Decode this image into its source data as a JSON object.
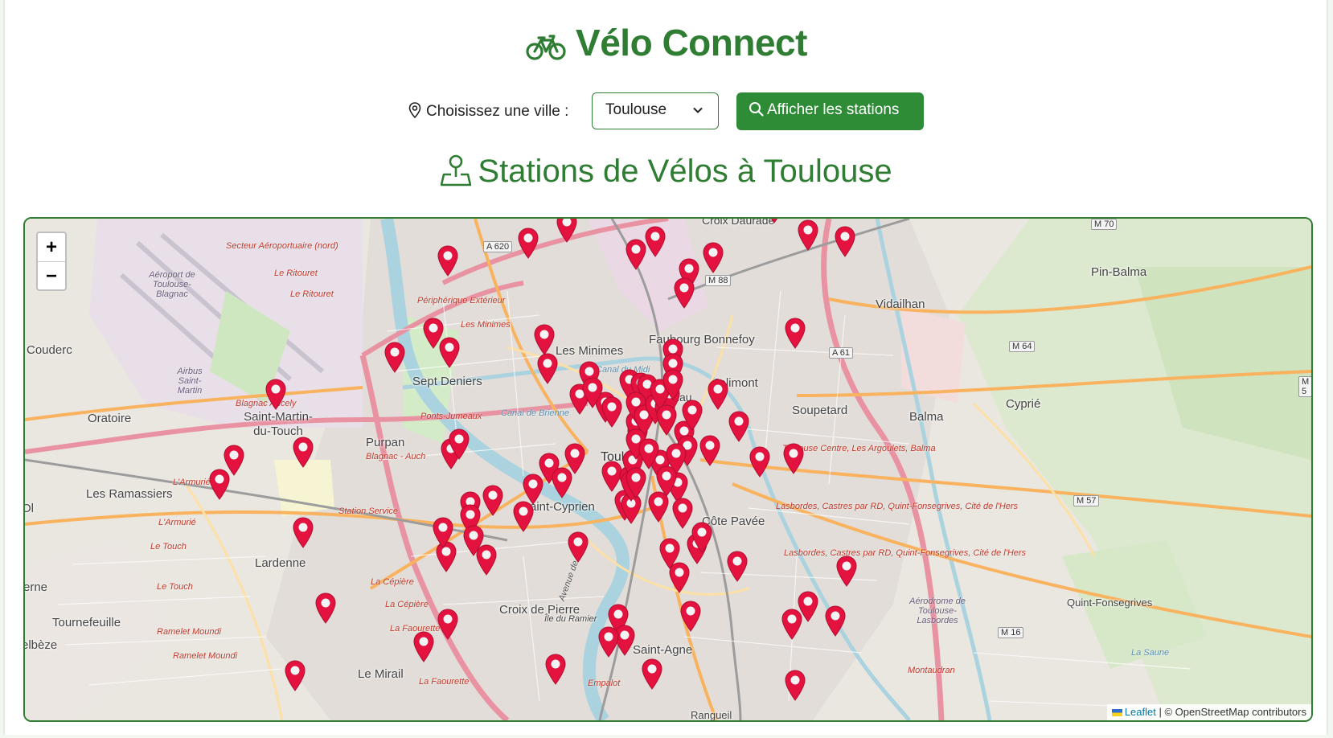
{
  "header": {
    "title": "Vélo Connect",
    "icon": "bicycle-icon",
    "brand_color": "#2e7d32"
  },
  "controls": {
    "city_label": "Choisissez une ville :",
    "city_value": "Toulouse",
    "button_label": "Afficher les stations"
  },
  "section": {
    "title": "Stations de Vélos à Toulouse"
  },
  "map": {
    "zoom_in": "+",
    "zoom_out": "−",
    "attribution_link": "Leaflet",
    "attribution_text": "| © OpenStreetMap contributors",
    "marker_color": "#e3123f",
    "marker_count": 103,
    "places": [
      "Couderc",
      "Oratoire",
      "Saint-Martin-du-Touch",
      "Les Ramassiers",
      "Purpan",
      "Sept Deniers",
      "Les Minimes",
      "Faubourg Bonnefoy",
      "Jolimont",
      "Soupetard",
      "Balma",
      "Cyprié",
      "Vidailhan",
      "Pin-Balma",
      "Toulouse",
      "Saint-Cyprien",
      "Côte Pavée",
      "Lardenne",
      "Tournefeuille",
      "Croix de Pierre",
      "Saint-Agne",
      "Le Mirail",
      "Quint-Fonsegrives",
      "Matabiau",
      "Croix Daurade",
      "Île du Ramier",
      "Ol",
      "erne",
      "elbèze",
      "Rangueil"
    ],
    "road_labels": [
      "Secteur Aéroportuaire (nord)",
      "Le Ritouret",
      "Le Ritouret",
      "Périphérique Extérieur",
      "Les Minimes",
      "Ponts-Jumeaux",
      "Blagnac Ancely",
      "Blagnac - Auch",
      "L'Armurié",
      "L'Armurié",
      "Le Touch",
      "Le Touch",
      "Ramelet Moundi",
      "Ramelet Moundi",
      "Station Service",
      "La Cépière",
      "La Cépière",
      "La Faourette",
      "La Faourette",
      "Toulouse Centre, Les Argoulets, Balma",
      "Lasbordes, Castres par RD, Quint-Fonsegrives, Cité de l'Hers",
      "Lasbordes, Castres par RD, Quint-Fonsegrives, Cité de l'Hers",
      "Canal de Brienne",
      "Canal du Midi",
      "Montaudran",
      "Empalot",
      "Aéroport de Toulouse-Blagnac",
      "Airbus Saint-Martin",
      "Aérodrome de Toulouse-Lasbordes",
      "La Saune",
      "Avenue de Muret"
    ],
    "shields": [
      "A 620",
      "A 61",
      "M 64",
      "M 70",
      "M 57",
      "M 16",
      "M 5",
      "M 88"
    ]
  }
}
